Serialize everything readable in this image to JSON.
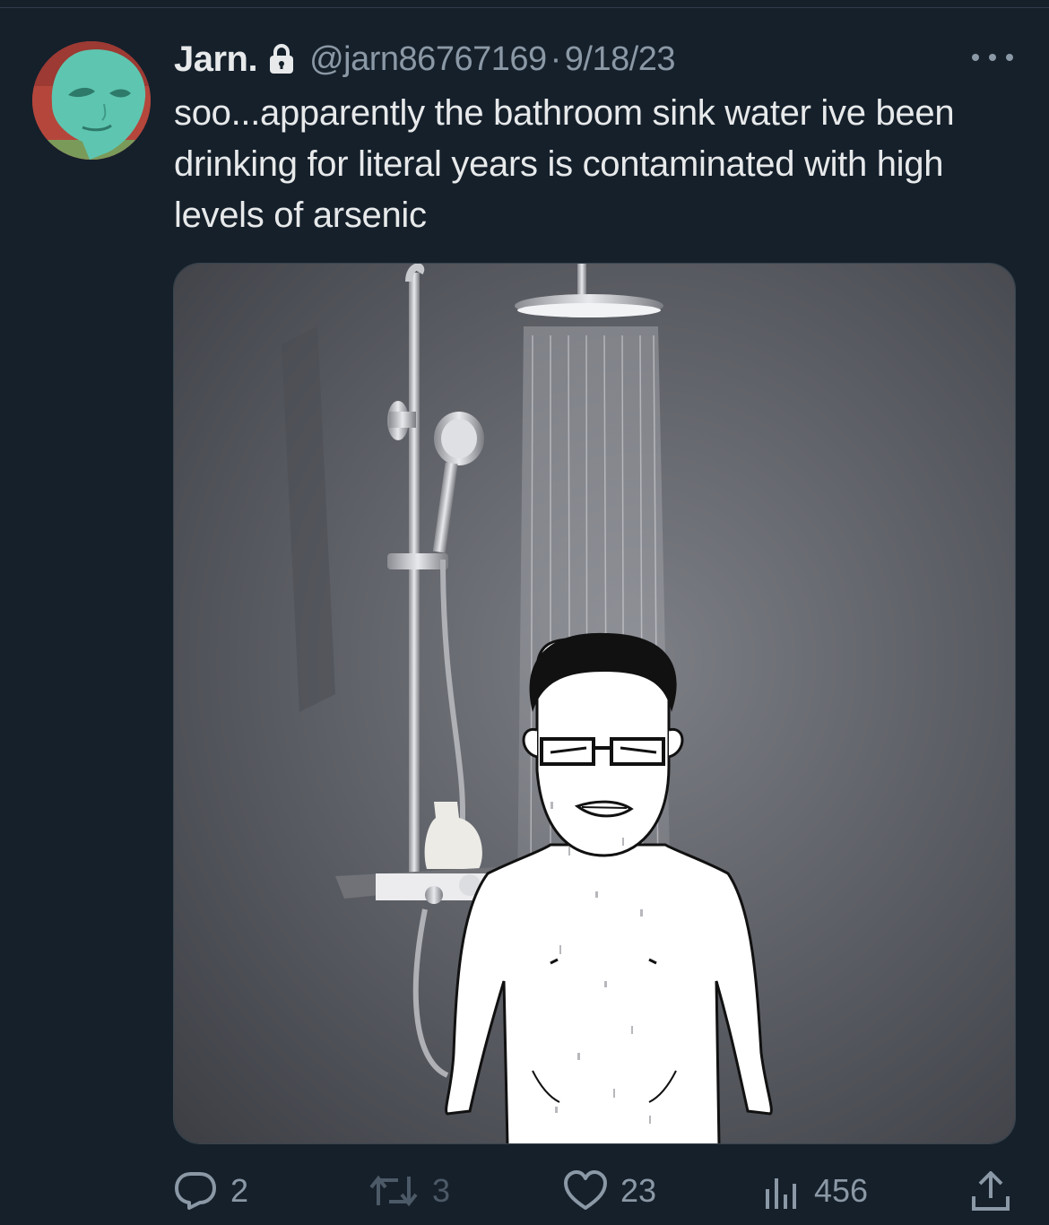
{
  "tweet": {
    "author": {
      "display_name": "Jarn.",
      "handle": "@jarn86767169",
      "protected": true
    },
    "separator": "·",
    "date": "9/18/23",
    "text": "soo...apparently the bathroom sink water ive been drinking for literal years is contaminated with high levels of arsenic",
    "media": {
      "type": "image",
      "description_icon": "meme-image"
    },
    "actions": {
      "replies": "2",
      "retweets": "3",
      "likes": "23",
      "views": "456"
    }
  },
  "colors": {
    "background": "#15202b",
    "primary_text": "#e7e9ea",
    "secondary_text": "#8b98a5",
    "muted_text": "#4c5966",
    "border": "#38444d"
  },
  "icons": {
    "lock": "lock-icon",
    "more": "more-icon",
    "reply": "reply-icon",
    "retweet": "retweet-icon",
    "like": "heart-icon",
    "views": "views-icon",
    "share": "share-icon"
  }
}
